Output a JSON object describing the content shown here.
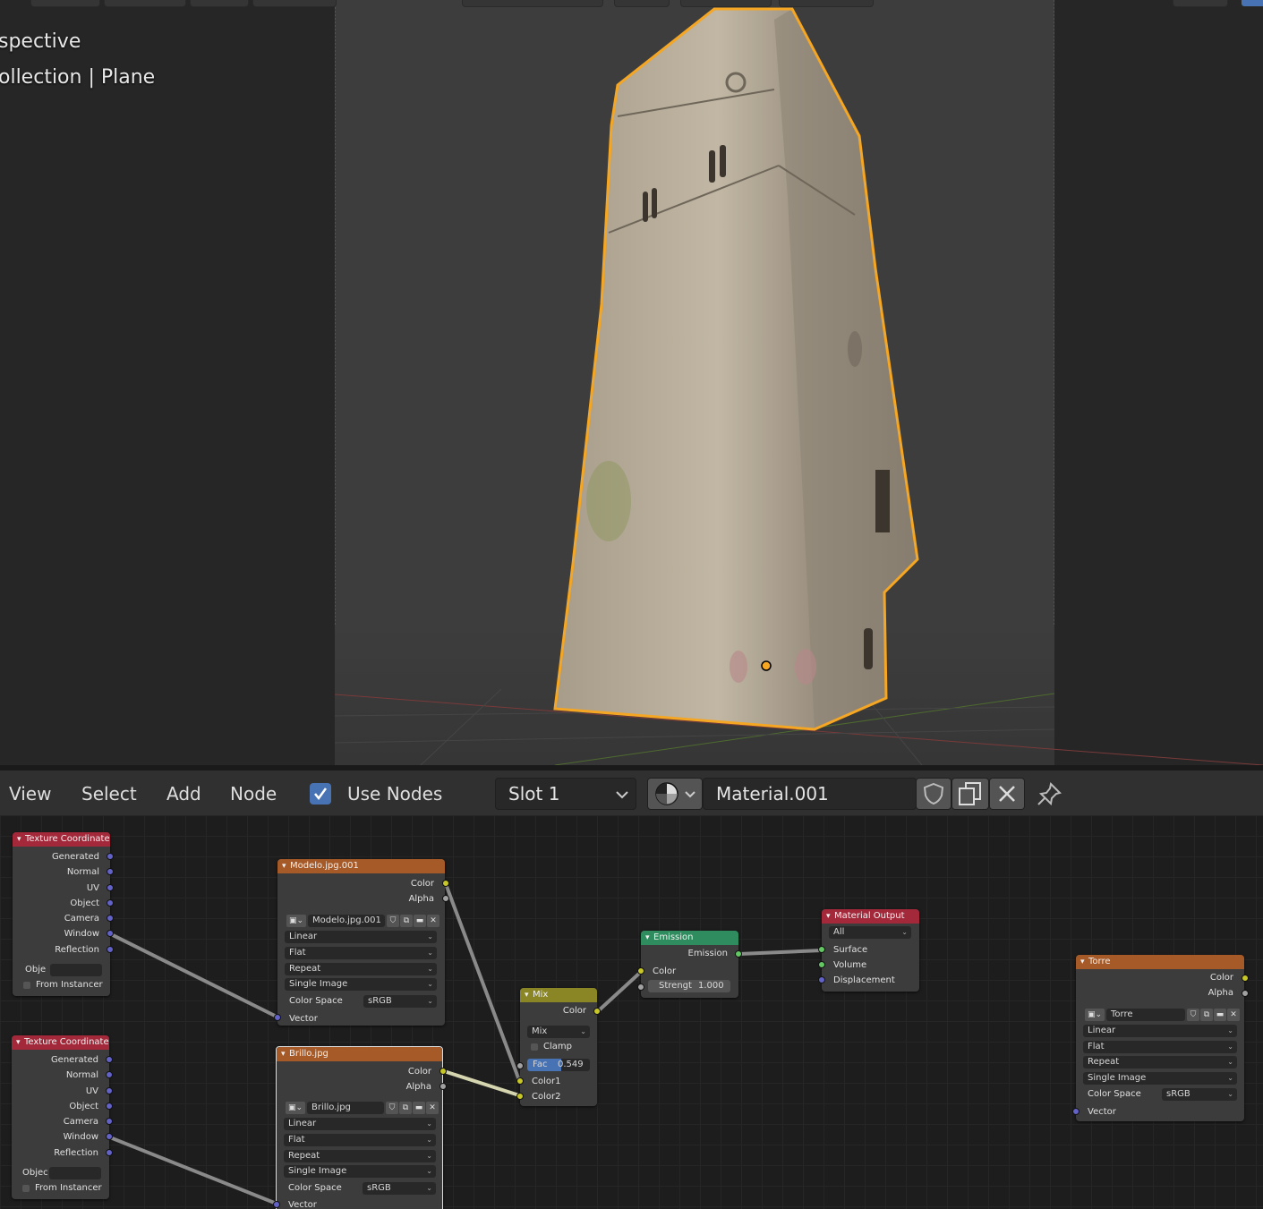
{
  "viewport": {
    "overlay_line1": "spective",
    "overlay_line2": "ollection | Plane"
  },
  "node_header": {
    "menu": [
      "View",
      "Select",
      "Add",
      "Node"
    ],
    "use_nodes_label": "Use Nodes",
    "use_nodes_checked": true,
    "slot": "Slot 1",
    "material_name": "Material.001"
  },
  "nodes": {
    "tex_coord_1": {
      "title": "Texture Coordinate",
      "outputs": [
        "Generated",
        "Normal",
        "UV",
        "Object",
        "Camera",
        "Window",
        "Reflection"
      ],
      "object_label": "Obje",
      "from_instancer": "From Instancer"
    },
    "tex_coord_2": {
      "title": "Texture Coordinate",
      "outputs": [
        "Generated",
        "Normal",
        "UV",
        "Object",
        "Camera",
        "Window",
        "Reflection"
      ],
      "object_label": "Objec",
      "from_instancer": "From Instancer"
    },
    "modelo": {
      "title": "Modelo.jpg.001",
      "out_color": "Color",
      "out_alpha": "Alpha",
      "image_name": "Modelo.jpg.001",
      "interpolation": "Linear",
      "projection": "Flat",
      "extension": "Repeat",
      "source": "Single Image",
      "color_space_label": "Color Space",
      "color_space": "sRGB",
      "in_vector": "Vector"
    },
    "brillo": {
      "title": "Brillo.jpg",
      "out_color": "Color",
      "out_alpha": "Alpha",
      "image_name": "Brillo.jpg",
      "interpolation": "Linear",
      "projection": "Flat",
      "extension": "Repeat",
      "source": "Single Image",
      "color_space_label": "Color Space",
      "color_space": "sRGB",
      "in_vector": "Vector"
    },
    "mix": {
      "title": "Mix",
      "out_color": "Color",
      "blend": "Mix",
      "clamp": "Clamp",
      "fac_label": "Fac",
      "fac_value": "0.549",
      "fac_fraction": 0.549,
      "in_color1": "Color1",
      "in_color2": "Color2"
    },
    "emission": {
      "title": "Emission",
      "out_emission": "Emission",
      "in_color": "Color",
      "strength_label": "Strengt",
      "strength_value": "1.000"
    },
    "material_output": {
      "title": "Material Output",
      "target": "All",
      "in_surface": "Surface",
      "in_volume": "Volume",
      "in_displacement": "Displacement"
    },
    "torre": {
      "title": "Torre",
      "out_color": "Color",
      "out_alpha": "Alpha",
      "image_name": "Torre",
      "interpolation": "Linear",
      "projection": "Flat",
      "extension": "Repeat",
      "source": "Single Image",
      "color_space_label": "Color Space",
      "color_space": "sRGB",
      "in_vector": "Vector"
    }
  },
  "colors": {
    "selection_outline": "#f5a623",
    "accent_blue": "#4772b3",
    "header_input": "#a3283a",
    "header_texture": "#a65a28",
    "header_shader": "#2f8c5e",
    "header_color": "#8a8625"
  },
  "icons": [
    "sphere-material-icon",
    "fake-user-shield-icon",
    "duplicate-icon",
    "close-icon",
    "pin-icon",
    "image-icon",
    "folder-icon",
    "checkbox-icon"
  ]
}
